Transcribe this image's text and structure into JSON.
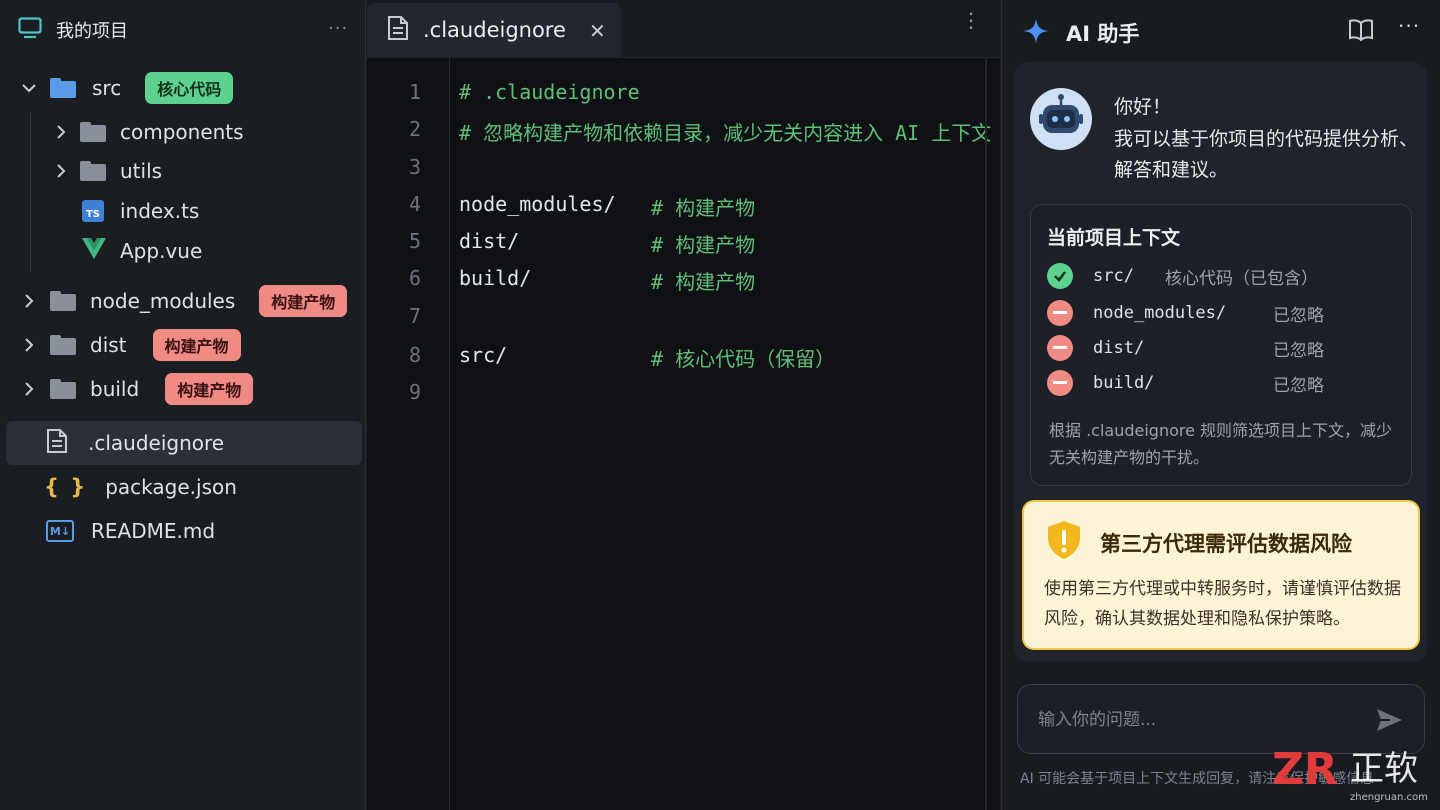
{
  "sidebar": {
    "title": "我的项目",
    "more": "···",
    "tree": [
      {
        "name": "src",
        "type": "folder",
        "expanded": true,
        "badge": "核心代码",
        "badge_color": "green"
      },
      {
        "name": "components",
        "type": "folder",
        "expanded": false
      },
      {
        "name": "utils",
        "type": "folder",
        "expanded": false
      },
      {
        "name": "index.ts",
        "type": "file",
        "icon": "typescript-icon",
        "icon_text": "TS"
      },
      {
        "name": "App.vue",
        "type": "file",
        "icon": "vue-icon"
      },
      {
        "name": "node_modules",
        "type": "folder",
        "expanded": false,
        "badge": "构建产物",
        "badge_color": "red"
      },
      {
        "name": "dist",
        "type": "folder",
        "expanded": false,
        "badge": "构建产物",
        "badge_color": "red"
      },
      {
        "name": "build",
        "type": "folder",
        "expanded": false,
        "badge": "构建产物",
        "badge_color": "red"
      },
      {
        "name": ".claudeignore",
        "type": "file",
        "icon": "document-icon",
        "selected": true
      },
      {
        "name": "package.json",
        "type": "file",
        "icon": "json-braces-icon",
        "icon_text": "{ }"
      },
      {
        "name": "README.md",
        "type": "file",
        "icon": "markdown-icon",
        "icon_text": "M↓"
      }
    ]
  },
  "editor": {
    "tab": {
      "label": ".claudeignore",
      "close": "✕"
    },
    "more": "⋮",
    "lines": [
      {
        "n": "1",
        "code": "",
        "comment": "# .claudeignore"
      },
      {
        "n": "2",
        "code": "",
        "comment": "# 忽略构建产物和依赖目录，减少无关内容进入 AI 上下文"
      },
      {
        "n": "3",
        "code": "",
        "comment": ""
      },
      {
        "n": "4",
        "code": "node_modules/",
        "comment": "# 构建产物"
      },
      {
        "n": "5",
        "code": "dist/",
        "comment": "# 构建产物"
      },
      {
        "n": "6",
        "code": "build/",
        "comment": "# 构建产物"
      },
      {
        "n": "7",
        "code": "",
        "comment": ""
      },
      {
        "n": "8",
        "code": "src/",
        "comment": "# 核心代码（保留）"
      },
      {
        "n": "9",
        "code": "",
        "comment": ""
      }
    ]
  },
  "ai": {
    "title": "AI 助手",
    "greeting": [
      "你好！",
      "我可以基于你项目的代码提供分析、",
      "解答和建议。"
    ],
    "context": {
      "title": "当前项目上下文",
      "items": [
        {
          "path": "src/",
          "status": "核心代码（已包含）",
          "state": "included"
        },
        {
          "path": "node_modules/",
          "status": "已忽略",
          "state": "ignored"
        },
        {
          "path": "dist/",
          "status": "已忽略",
          "state": "ignored"
        },
        {
          "path": "build/",
          "status": "已忽略",
          "state": "ignored"
        }
      ],
      "note": "根据 .claudeignore 规则筛选项目上下文，减少无关构建产物的干扰。"
    },
    "warning": {
      "title": "第三方代理需评估数据风险",
      "body": "使用第三方代理或中转服务时，请谨慎评估数据风险，确认其数据处理和隐私保护策略。"
    },
    "input": {
      "placeholder": "输入你的问题..."
    },
    "disclaimer": "AI 可能会基于项目上下文生成回复，请注意保护敏感信息"
  },
  "watermark": {
    "text": "正软",
    "sub": "zhengruan.com"
  },
  "colors": {
    "accent_blue": "#4f8ff0",
    "green": "#5fd18e",
    "red": "#f08a84",
    "comment": "#5fbf78",
    "warning_bg": "#fdf3d6"
  }
}
